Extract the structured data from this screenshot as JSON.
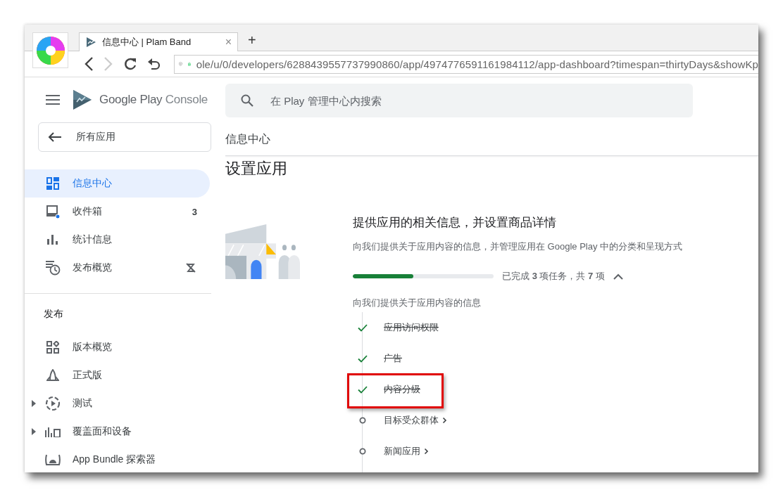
{
  "browser": {
    "tab": {
      "title": "信息中心 | Plam Band",
      "close": "×"
    },
    "new_tab": "+",
    "nav": {
      "back_disabled": false,
      "forward_disabled": true
    },
    "address": "ole/u/0/developers/6288439557737990860/app/4974776591161984112/app-dashboard?timespan=thirtyDays&showKp"
  },
  "sidebar": {
    "brand_main": "Google Play",
    "brand_sub": "Console",
    "back_button": "所有应用",
    "items": [
      {
        "label": "信息中心",
        "selected": true
      },
      {
        "label": "收件箱",
        "selected": false,
        "count": "3",
        "unread": true
      },
      {
        "label": "统计信息",
        "selected": false
      },
      {
        "label": "发布概览",
        "selected": false,
        "muted": true
      }
    ],
    "section": "发布",
    "section_items": [
      {
        "label": "版本概览",
        "selected": false
      },
      {
        "label": "正式版",
        "selected": false
      },
      {
        "label": "测试",
        "selected": false,
        "expanded": false
      },
      {
        "label": "覆盖面和设备",
        "selected": false,
        "expanded": false
      },
      {
        "label": "App Bundle 探索器",
        "selected": false
      }
    ]
  },
  "search": {
    "placeholder": "在 Play 管理中心内搜索"
  },
  "breadcrumb": "信息中心",
  "page_title": "设置应用",
  "setup": {
    "title": "提供应用的相关信息，并设置商品详情",
    "description": "向我们提供关于应用内容的信息，并管理应用在 Google Play 中的分类和呈现方式",
    "progress": {
      "level": 0.43,
      "text": "已完成 **3** 项任务，共 **7** 项",
      "expanded": true
    },
    "group": "向我们提供关于应用内容的信息",
    "tasks": [
      {
        "label": "应用访问权限",
        "done": true,
        "highlighted": false
      },
      {
        "label": "广告",
        "done": true,
        "highlighted": false
      },
      {
        "label": "内容分级",
        "done": true,
        "highlighted": true
      },
      {
        "label": "目标受众群体",
        "done": false,
        "highlighted": false
      },
      {
        "label": "新闻应用",
        "done": false,
        "highlighted": false
      }
    ]
  }
}
